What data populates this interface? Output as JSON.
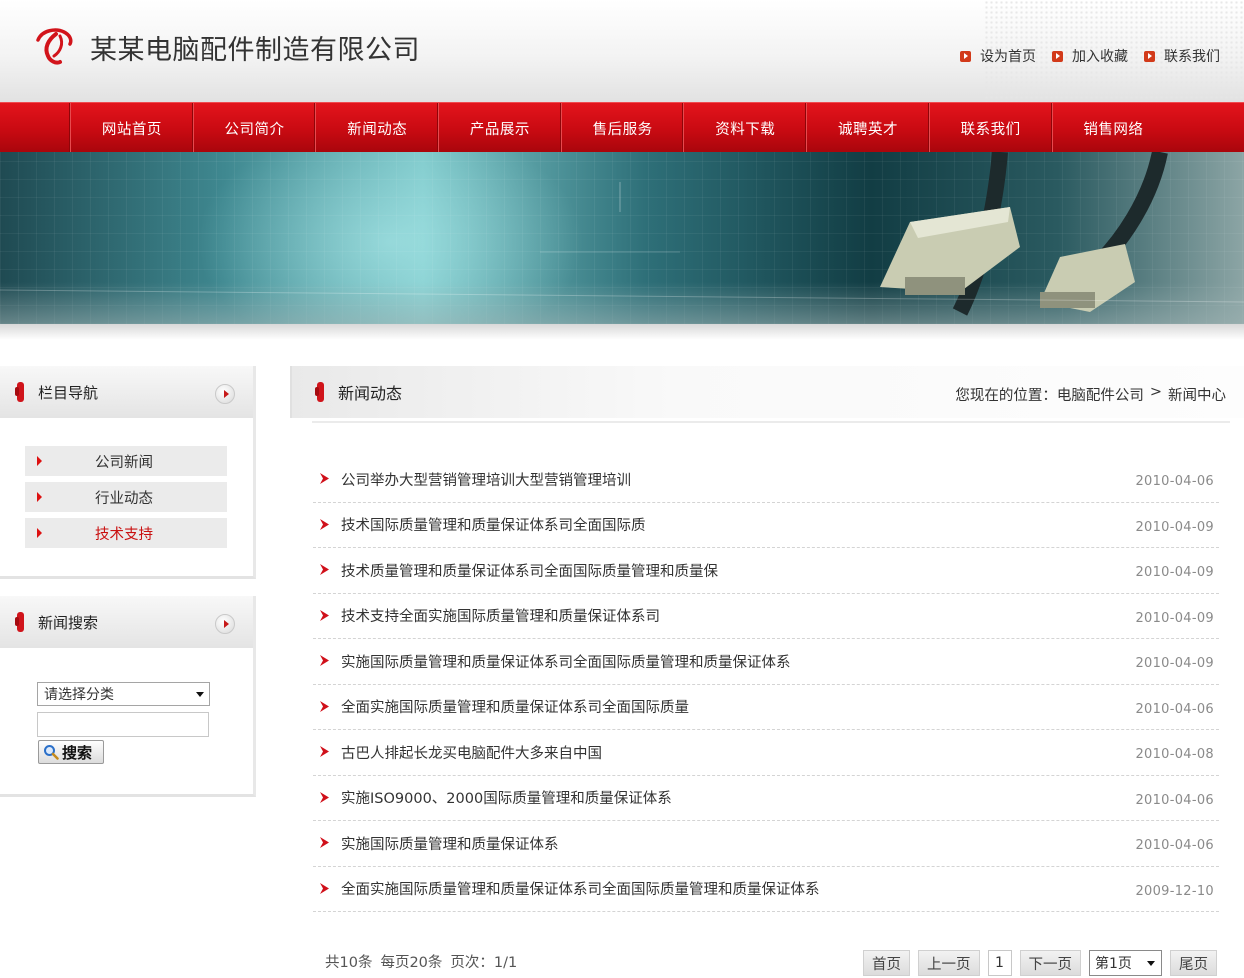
{
  "header": {
    "company_name": "某某电脑配件制造有限公司",
    "top_links": [
      "设为首页",
      "加入收藏",
      "联系我们"
    ]
  },
  "nav": {
    "items": [
      "网站首页",
      "公司简介",
      "新闻动态",
      "产品展示",
      "售后服务",
      "资料下载",
      "诚聘英才",
      "联系我们",
      "销售网络"
    ]
  },
  "sidebar": {
    "nav_title": "栏目导航",
    "categories": [
      {
        "label": "公司新闻",
        "active": false
      },
      {
        "label": "行业动态",
        "active": false
      },
      {
        "label": "技术支持",
        "active": true
      }
    ],
    "search_title": "新闻搜索",
    "search_select_value": "请选择分类",
    "search_input_value": "",
    "search_button_label": "搜索"
  },
  "main": {
    "title": "新闻动态",
    "breadcrumb_prefix": "您现在的位置：电脑配件公司",
    "breadcrumb_sep": ">",
    "breadcrumb_current": "新闻中心",
    "news": [
      {
        "title": "公司举办大型营销管理培训大型营销管理培训",
        "date": "2010-04-06"
      },
      {
        "title": "技术国际质量管理和质量保证体系司全面国际质",
        "date": "2010-04-09"
      },
      {
        "title": "技术质量管理和质量保证体系司全面国际质量管理和质量保",
        "date": "2010-04-09"
      },
      {
        "title": "技术支持全面实施国际质量管理和质量保证体系司",
        "date": "2010-04-09"
      },
      {
        "title": "实施国际质量管理和质量保证体系司全面国际质量管理和质量保证体系",
        "date": "2010-04-09"
      },
      {
        "title": "全面实施国际质量管理和质量保证体系司全面国际质量",
        "date": "2010-04-06"
      },
      {
        "title": "古巴人排起长龙买电脑配件大多来自中国",
        "date": "2010-04-08"
      },
      {
        "title": "实施ISO9000、2000国际质量管理和质量保证体系",
        "date": "2010-04-06"
      },
      {
        "title": "实施国际质量管理和质量保证体系",
        "date": "2010-04-06"
      },
      {
        "title": "全面实施国际质量管理和质量保证体系司全面国际质量管理和质量保证体系",
        "date": "2009-12-10"
      }
    ],
    "pager": {
      "total": "共10条",
      "per_page": "每页20条",
      "pages": "页次：1/1",
      "first": "首页",
      "prev": "上一页",
      "current": "1",
      "next": "下一页",
      "select_value": "第1页",
      "last": "尾页"
    }
  },
  "colors": {
    "brand_red": "#d0101a",
    "accent_red": "#c91010"
  }
}
